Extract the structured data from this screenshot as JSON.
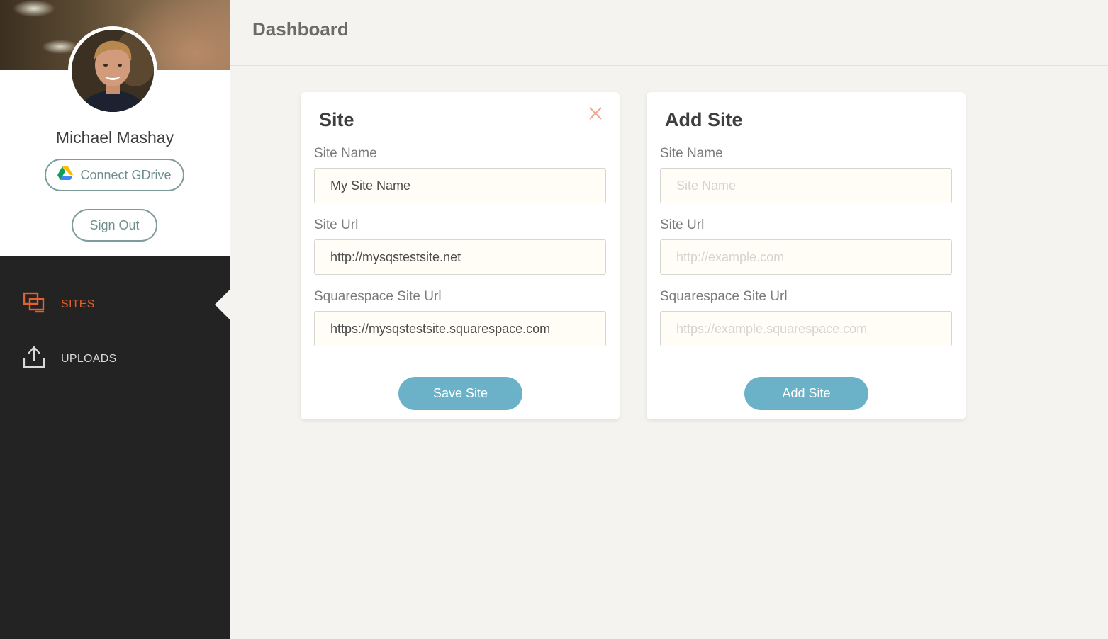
{
  "header": {
    "title": "Dashboard"
  },
  "profile": {
    "name": "Michael Mashay",
    "connect_label": "Connect GDrive",
    "signout_label": "Sign Out"
  },
  "nav": {
    "items": [
      {
        "label": "SITES",
        "icon": "sites-icon",
        "active": true
      },
      {
        "label": "UPLOADS",
        "icon": "upload-icon",
        "active": false
      }
    ]
  },
  "site_card": {
    "title": "Site",
    "fields": [
      {
        "label": "Site Name",
        "value": "My Site Name"
      },
      {
        "label": "Site Url",
        "value": "http://mysqstestsite.net"
      },
      {
        "label": "Squarespace Site Url",
        "value": "https://mysqstestsite.squarespace.com"
      }
    ],
    "button_label": "Save Site"
  },
  "add_card": {
    "title": "Add Site",
    "fields": [
      {
        "label": "Site Name",
        "placeholder": "Site Name"
      },
      {
        "label": "Site Url",
        "placeholder": "http://example.com"
      },
      {
        "label": "Squarespace Site Url",
        "placeholder": "https://example.squarespace.com"
      }
    ],
    "button_label": "Add Site"
  },
  "colors": {
    "accent": "#e4612b",
    "primary_button": "#6bb2c9",
    "sidebar_dark": "#232323",
    "outline_button": "#7f9c9c",
    "page_bg": "#f4f3ef"
  }
}
